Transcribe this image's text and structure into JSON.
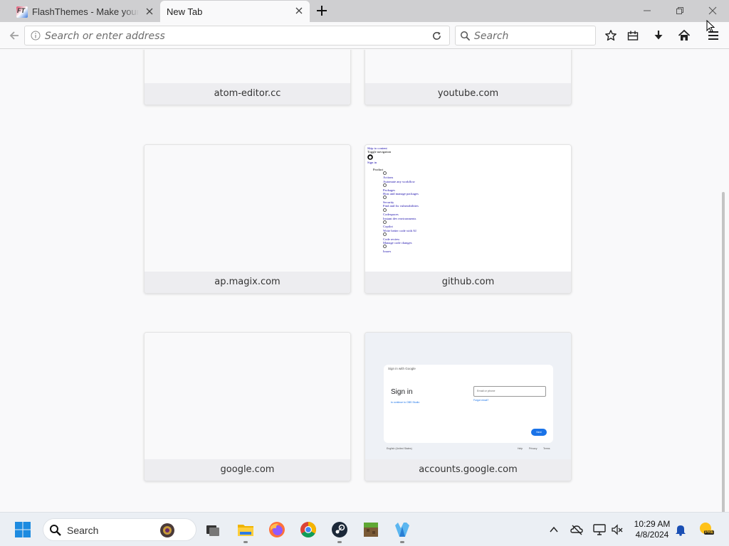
{
  "browser": {
    "tabs": [
      {
        "title": "FlashThemes - Make your own",
        "active": false
      },
      {
        "title": "New Tab",
        "active": true
      }
    ],
    "address_placeholder": "Search or enter address",
    "search_placeholder": "Search"
  },
  "top_sites": [
    {
      "label": "atom-editor.cc"
    },
    {
      "label": "youtube.com"
    },
    {
      "label": "ap.magix.com"
    },
    {
      "label": "github.com"
    },
    {
      "label": "google.com"
    },
    {
      "label": "accounts.google.com"
    }
  ],
  "github_thumb": {
    "lines": [
      "Skip to content",
      "Toggle navigation",
      "Sign in",
      "Product",
      "Actions",
      "Automate any workflow",
      "Packages",
      "Host and manage packages",
      "Security",
      "Find and fix vulnerabilities",
      "Codespaces",
      "Instant dev environments",
      "Copilot",
      "Write better code with AI",
      "Code review",
      "Manage code changes",
      "Issues"
    ]
  },
  "google_thumb": {
    "header": "Sign in with Google",
    "title": "Sign in",
    "subtitle": "to continue to OBS Studio",
    "email_placeholder": "Email or phone",
    "forgot": "Forgot email?",
    "next": "Next",
    "footer_lang": "English (United States)",
    "footer_links": [
      "Help",
      "Privacy",
      "Terms"
    ]
  },
  "taskbar": {
    "search_label": "Search",
    "time": "10:29 AM",
    "date": "4/8/2024",
    "weather_badge": "PRE"
  }
}
